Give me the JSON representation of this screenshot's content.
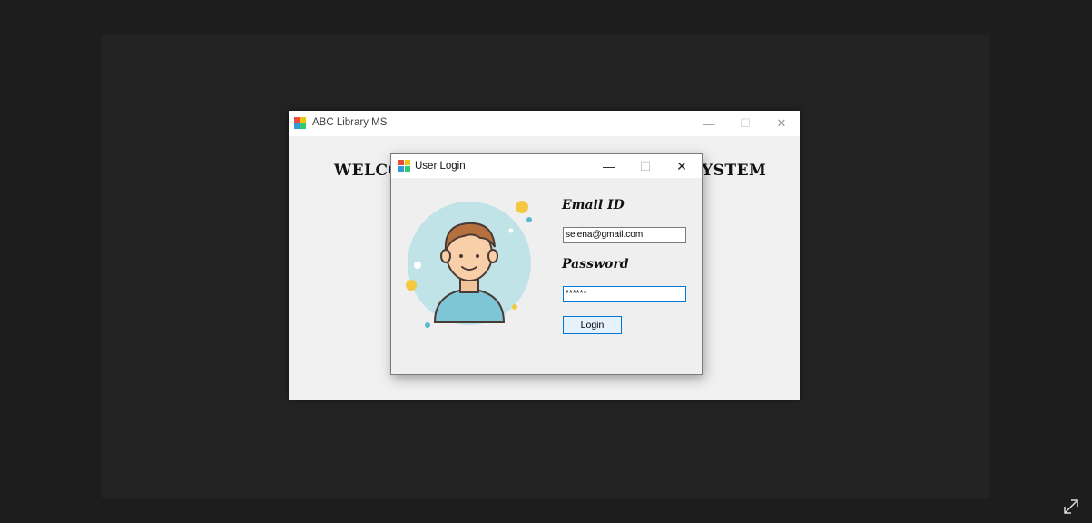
{
  "main_window": {
    "title": "ABC Library MS",
    "welcome_left": "WELCO",
    "welcome_right": "YSTEM",
    "controls": {
      "minimize": "—",
      "maximize": "☐",
      "close": "✕"
    }
  },
  "login_dialog": {
    "title": "User Login",
    "controls": {
      "minimize": "—",
      "maximize": "☐",
      "close": "✕"
    },
    "email_label": "Email ID",
    "email_value": "selena@gmail.com",
    "password_label": "Password",
    "password_value": "******",
    "login_button": "Login"
  },
  "colors": {
    "focus_border": "#0078d7",
    "button_bg": "#e5f1fb",
    "window_bg": "#f0f0f0",
    "desktop_bg": "#1d1d1d"
  },
  "icons": [
    "app-icon",
    "avatar-illustration",
    "expand-icon"
  ]
}
